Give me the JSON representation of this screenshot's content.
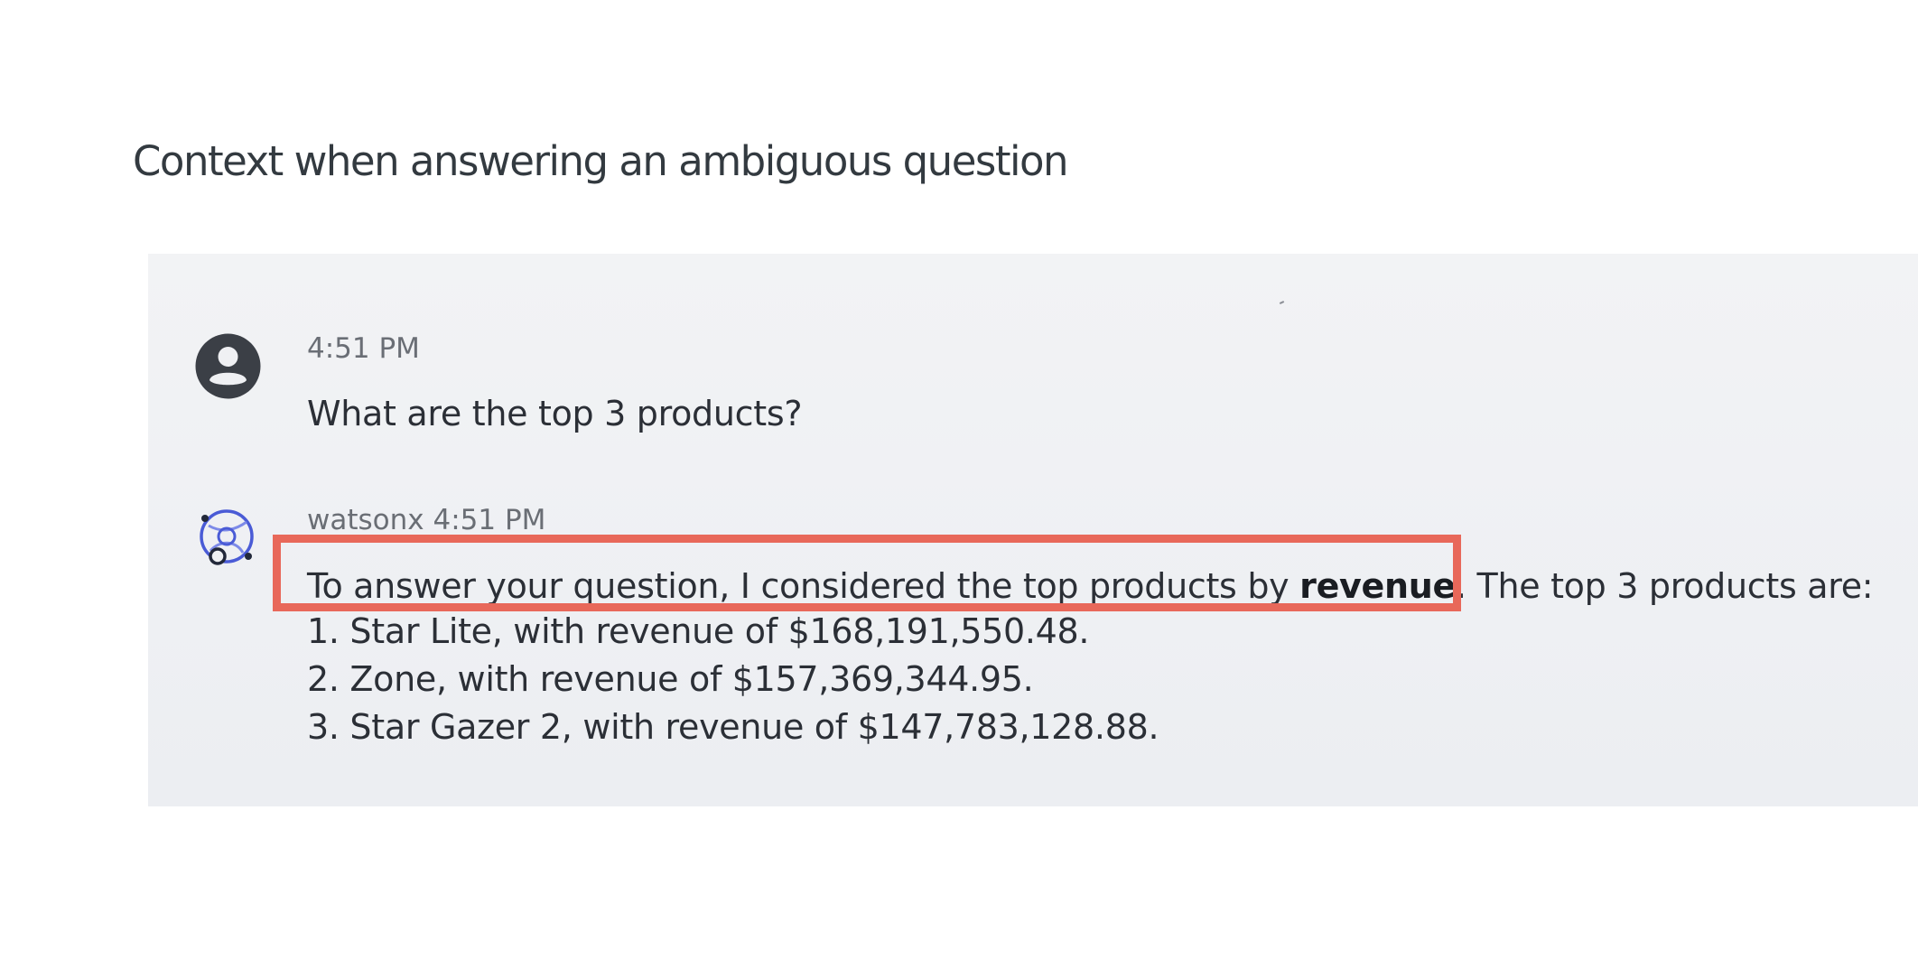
{
  "caption": "Context when answering an ambiguous question",
  "user_message": {
    "time": "4:51 PM",
    "text": "What are the top 3 products?"
  },
  "bot_message": {
    "sender": "watsonx",
    "time": "4:51 PM",
    "header": "watsonx 4:51 PM",
    "intro_before": "To answer your question, I considered the top products by ",
    "intro_bold": "revenue",
    "intro_after": ". The top 3 products are:",
    "items": [
      "1. Star Lite, with revenue of $168,191,550.48.",
      "2. Zone, with revenue of $157,369,344.95.",
      "3. Star Gazer 2, with revenue of $147,783,128.88."
    ]
  },
  "colors": {
    "highlight": "#e8685a",
    "panel_bg": "#eff0f3",
    "bot_icon": "#4a5bd6",
    "user_icon": "#3b3f46"
  },
  "icons": {
    "user_avatar": "user-avatar-icon",
    "bot_avatar": "watsonx-bot-icon"
  }
}
